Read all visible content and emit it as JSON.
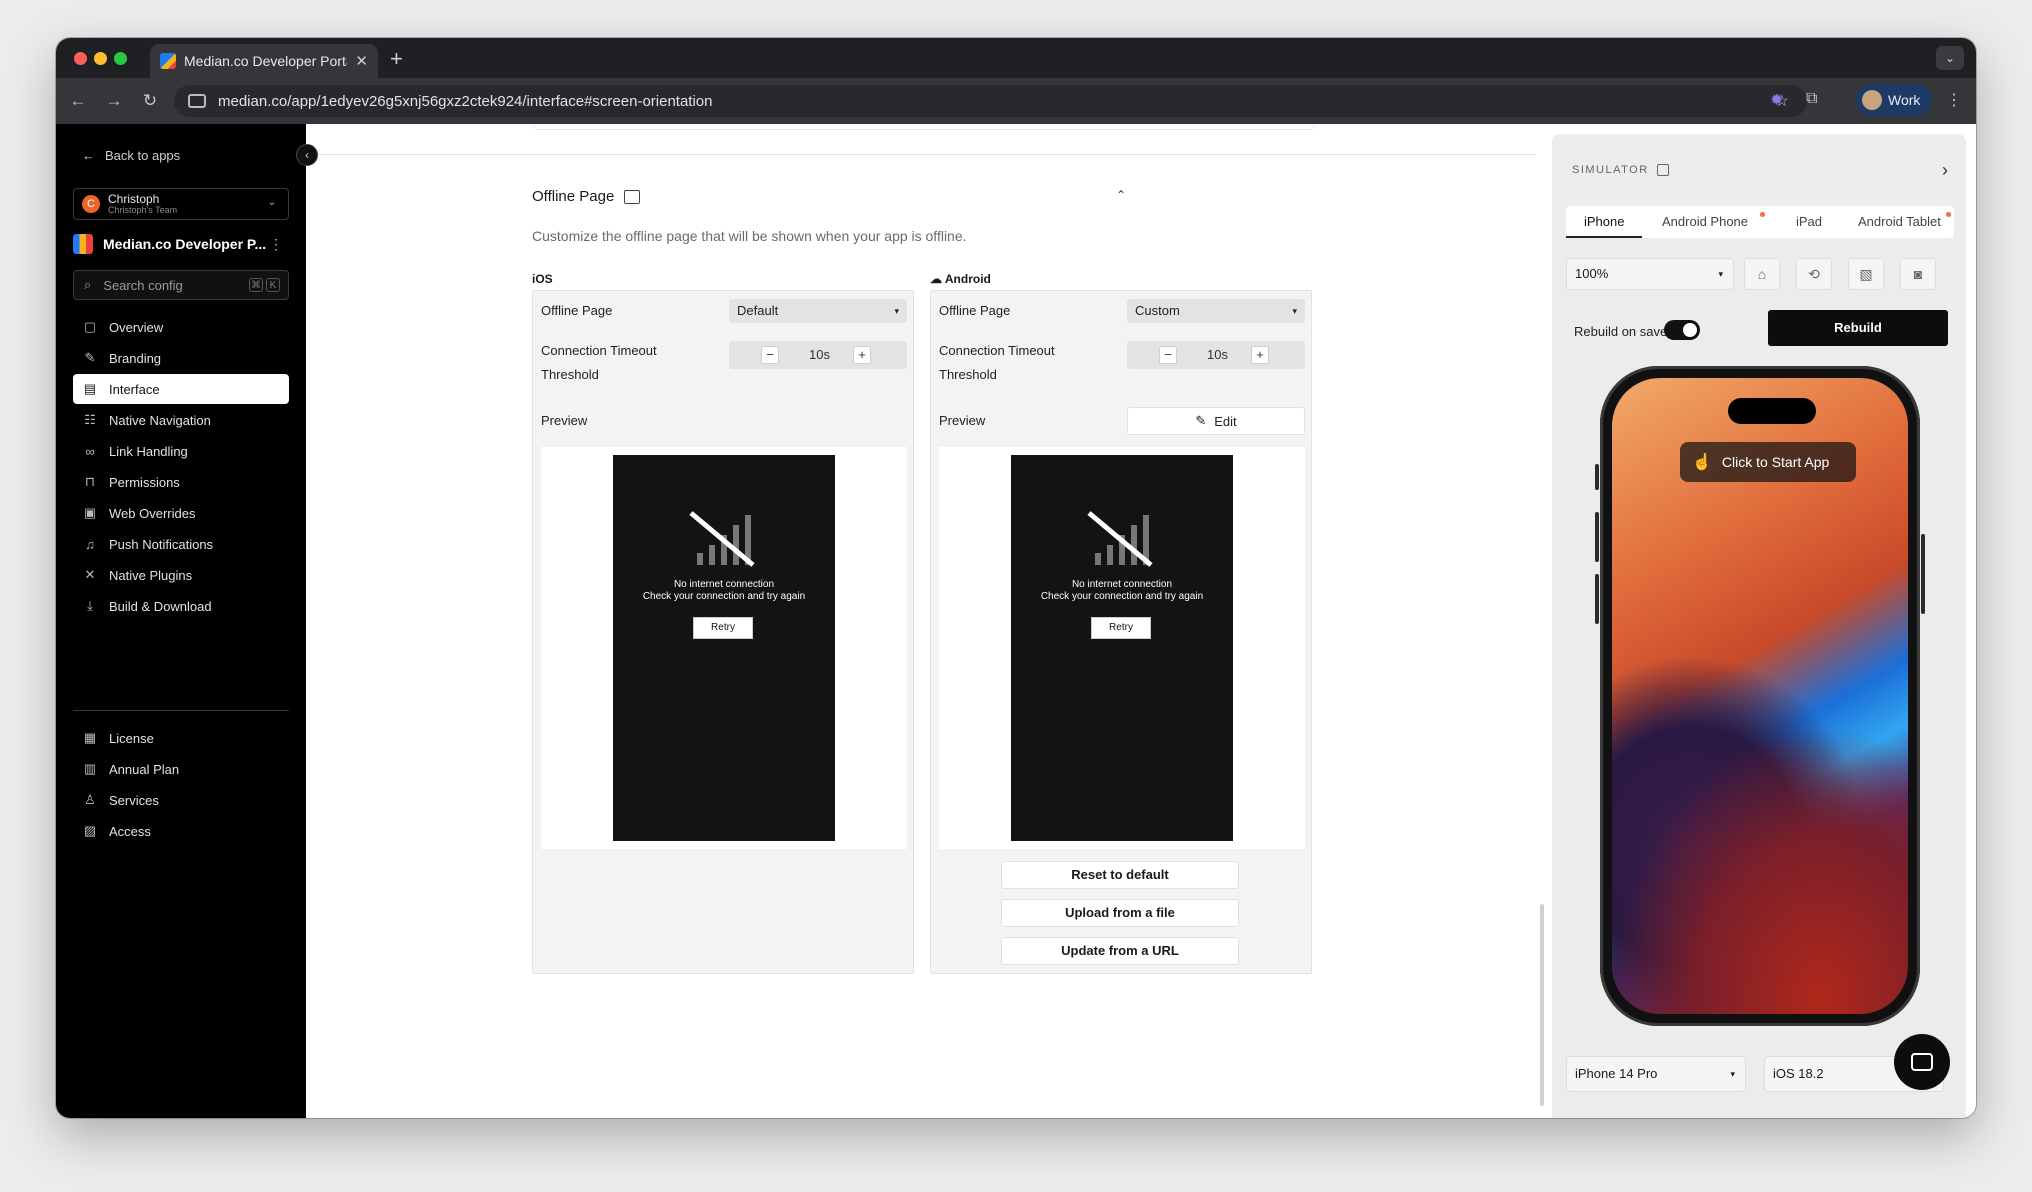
{
  "browser": {
    "tab_title": "Median.co Developer Portal -",
    "url": "median.co/app/1edyev26g5xnj56gxz2ctek924/interface#screen-orientation",
    "profile": "Work"
  },
  "sidebar": {
    "back": "Back to apps",
    "team": {
      "initial": "C",
      "name": "Christoph",
      "sub": "Christoph's Team"
    },
    "app_name": "Median.co Developer P...",
    "search_placeholder": "Search config",
    "kbd": [
      "⌘",
      "K"
    ],
    "items": [
      {
        "label": "Overview",
        "icon": "square-icon"
      },
      {
        "label": "Branding",
        "icon": "brush-icon"
      },
      {
        "label": "Interface",
        "icon": "layout-icon",
        "active": true
      },
      {
        "label": "Native Navigation",
        "icon": "navigation-icon"
      },
      {
        "label": "Link Handling",
        "icon": "link-icon"
      },
      {
        "label": "Permissions",
        "icon": "lock-icon"
      },
      {
        "label": "Web Overrides",
        "icon": "code-icon"
      },
      {
        "label": "Push Notifications",
        "icon": "bell-icon"
      },
      {
        "label": "Native Plugins",
        "icon": "plugin-icon"
      },
      {
        "label": "Build & Download",
        "icon": "download-icon"
      }
    ],
    "items2": [
      {
        "label": "License",
        "icon": "license-icon"
      },
      {
        "label": "Annual Plan",
        "icon": "calendar-icon"
      },
      {
        "label": "Services",
        "icon": "user-icon"
      },
      {
        "label": "Access",
        "icon": "access-icon"
      }
    ]
  },
  "main": {
    "section_title": "Offline Page",
    "section_desc": "Customize the offline page that will be shown when your app is offline.",
    "ios": {
      "label": "iOS",
      "offline_label": "Offline Page",
      "offline_value": "Default",
      "timeout_label_1": "Connection Timeout",
      "timeout_label_2": "Threshold",
      "timeout_value": "10s",
      "preview_label": "Preview",
      "msg1": "No internet connection",
      "msg2": "Check your connection and try again",
      "retry": "Retry"
    },
    "android": {
      "label": "Android",
      "offline_label": "Offline Page",
      "offline_value": "Custom",
      "timeout_label_1": "Connection Timeout",
      "timeout_label_2": "Threshold",
      "timeout_value": "10s",
      "preview_label": "Preview",
      "edit": "Edit",
      "msg1": "No internet connection",
      "msg2": "Check your connection and try again",
      "retry": "Retry",
      "reset": "Reset to default",
      "upload": "Upload from a file",
      "update_url": "Update from a URL"
    }
  },
  "simulator": {
    "title": "SIMULATOR",
    "tabs": [
      "iPhone",
      "Android Phone",
      "iPad",
      "Android Tablet"
    ],
    "zoom": "100%",
    "rebuild_on_save": "Rebuild on save",
    "rebuild": "Rebuild",
    "start": "Click to Start App",
    "device": "iPhone 14 Pro",
    "os": "iOS 18.2"
  },
  "colors": {
    "accent": "#0d0d0d",
    "notification_dot": "#f2713a",
    "team_avatar": "#e8662a"
  }
}
